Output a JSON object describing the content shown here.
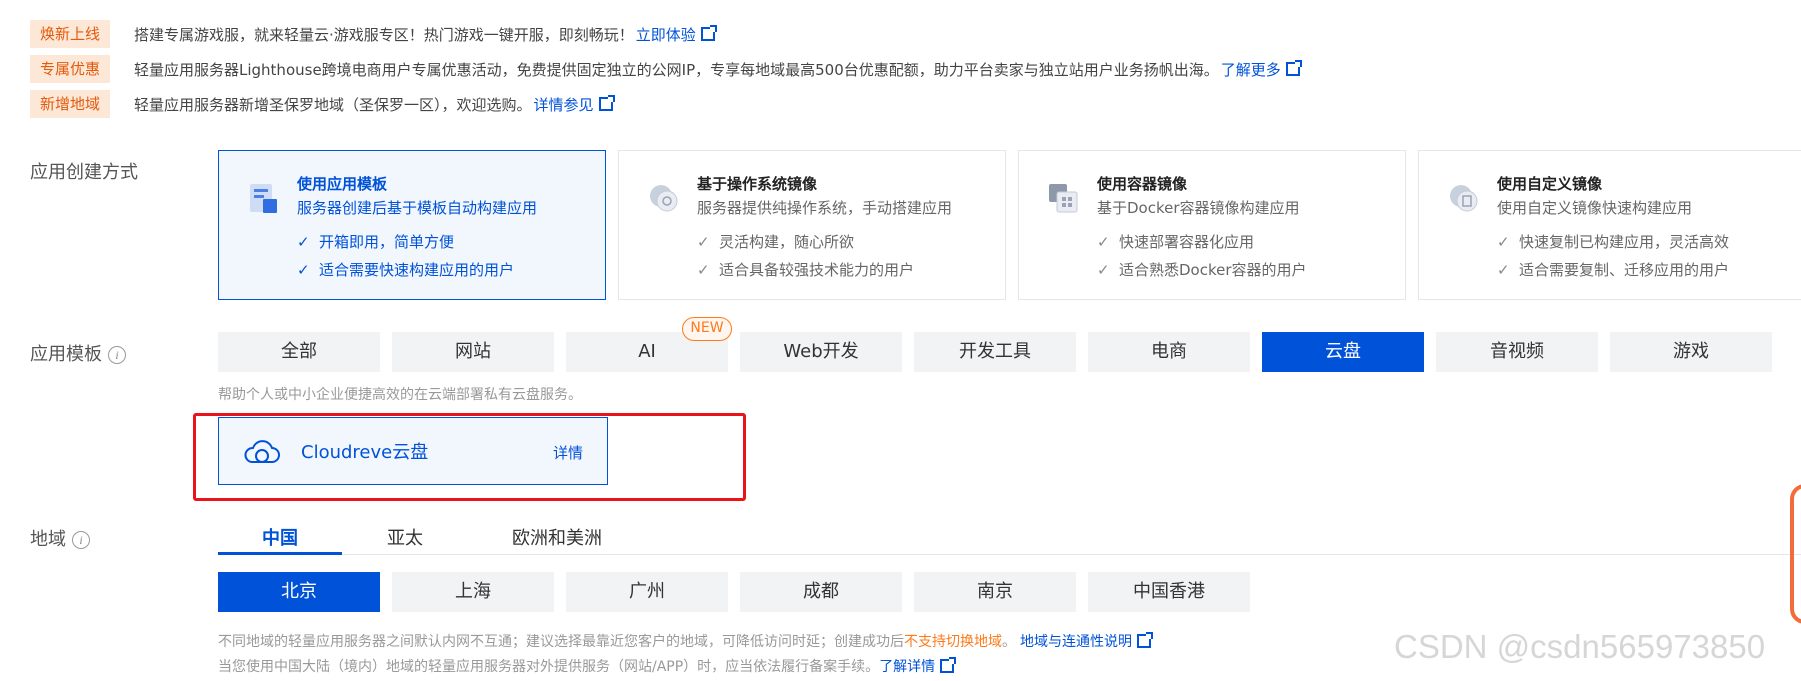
{
  "notices": [
    {
      "tag": "焕新上线",
      "text": "搭建专属游戏服，就来轻量云·游戏服专区！热门游戏一键开服，即刻畅玩！",
      "link": "立即体验"
    },
    {
      "tag": "专属优惠",
      "text": "轻量应用服务器Lighthouse跨境电商用户专属优惠活动，免费提供固定独立的公网IP，专享每地域最高500台优惠配额，助力平台卖家与独立站用户业务扬帆出海。",
      "link": "了解更多"
    },
    {
      "tag": "新增地域",
      "text": "轻量应用服务器新增圣保罗地域（圣保罗一区），欢迎选购。",
      "link": "详情参见"
    }
  ],
  "creation": {
    "label": "应用创建方式",
    "modes": [
      {
        "title": "使用应用模板",
        "subtitle": "服务器创建后基于模板自动构建应用",
        "features": [
          "开箱即用，简单方便",
          "适合需要快速构建应用的用户"
        ],
        "icon": "template-icon"
      },
      {
        "title": "基于操作系统镜像",
        "subtitle": "服务器提供纯操作系统，手动搭建应用",
        "features": [
          "灵活构建，随心所欲",
          "适合具备较强技术能力的用户"
        ],
        "icon": "os-image-icon"
      },
      {
        "title": "使用容器镜像",
        "subtitle": "基于Docker容器镜像构建应用",
        "features": [
          "快速部署容器化应用",
          "适合熟悉Docker容器的用户"
        ],
        "icon": "container-image-icon"
      },
      {
        "title": "使用自定义镜像",
        "subtitle": "使用自定义镜像快速构建应用",
        "features": [
          "快速复制已构建应用，灵活高效",
          "适合需要复制、迁移应用的用户"
        ],
        "icon": "custom-image-icon"
      }
    ]
  },
  "templates": {
    "label": "应用模板",
    "tabs": [
      "全部",
      "网站",
      "AI",
      "Web开发",
      "开发工具",
      "电商",
      "云盘",
      "音视频",
      "游戏"
    ],
    "new_badge": "NEW",
    "description": "帮助个人或中小企业便捷高效的在云端部署私有云盘服务。",
    "selected": {
      "name": "Cloudreve云盘",
      "detail": "详情",
      "icon": "cloud-icon"
    }
  },
  "region": {
    "label": "地域",
    "tabs": [
      "中国",
      "亚太",
      "欧洲和美洲"
    ],
    "cities": [
      "北京",
      "上海",
      "广州",
      "成都",
      "南京",
      "中国香港"
    ],
    "note1_pre": "不同地域的轻量应用服务器之间默认内网不互通；建议选择最靠近您客户的地域，可降低访问时延；创建成功后",
    "note1_warn": "不支持切换地域",
    "note1_post": "。",
    "note1_link": "地域与连通性说明",
    "note2": "当您使用中国大陆（境内）地域的轻量应用服务器对外提供服务（网站/APP）时，应当依法履行备案手续。",
    "note2_link": "了解详情"
  },
  "watermark": "CSDN @csdn565973850",
  "colors": {
    "primary": "#0052d9",
    "tag_bg": "#fde8d8",
    "tag_text": "#e35a0c",
    "warn": "#ff7a1a",
    "highlight": "#e8141a"
  }
}
